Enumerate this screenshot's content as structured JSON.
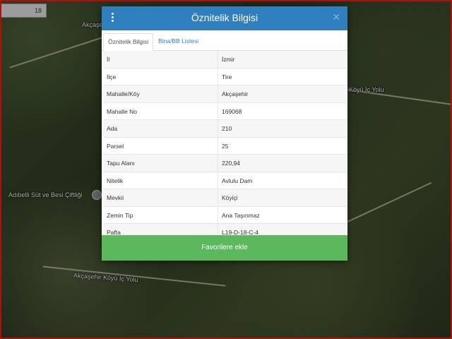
{
  "map": {
    "labels": {
      "road_top": "Akçaşe",
      "road_right": "Köyü İç Yolu",
      "poi": "Adıbelli Süt ve Besi Çiftliği",
      "road_bottom": "Akçaşehir Köyü İç Yolu"
    },
    "box_value": "18"
  },
  "modal": {
    "title": "Öznitelik Bilgisi",
    "tabs": [
      "Öznitelik Bilgisi",
      "Bina/BB Listesi"
    ],
    "rows": [
      {
        "key": "İl",
        "value": "İzmir"
      },
      {
        "key": "İlçe",
        "value": "Tire"
      },
      {
        "key": "Mahalle/Köy",
        "value": "Akçaşehir"
      },
      {
        "key": "Mahalle No",
        "value": "169068"
      },
      {
        "key": "Ada",
        "value": "210"
      },
      {
        "key": "Parsel",
        "value": "25"
      },
      {
        "key": "Tapu Alanı",
        "value": "220,94"
      },
      {
        "key": "Nitelik",
        "value": "Avlulu Dam"
      },
      {
        "key": "Mevkii",
        "value": "Köyiçi"
      },
      {
        "key": "Zemin Tip",
        "value": "Ana Taşınmaz"
      },
      {
        "key": "Pafta",
        "value": "L19-D-18-C-4"
      }
    ],
    "button_label": "Favorilere ekle"
  },
  "icons": {
    "menu": "vertical-dots-icon",
    "close": "close-icon",
    "poi": "poi-marker-icon"
  }
}
